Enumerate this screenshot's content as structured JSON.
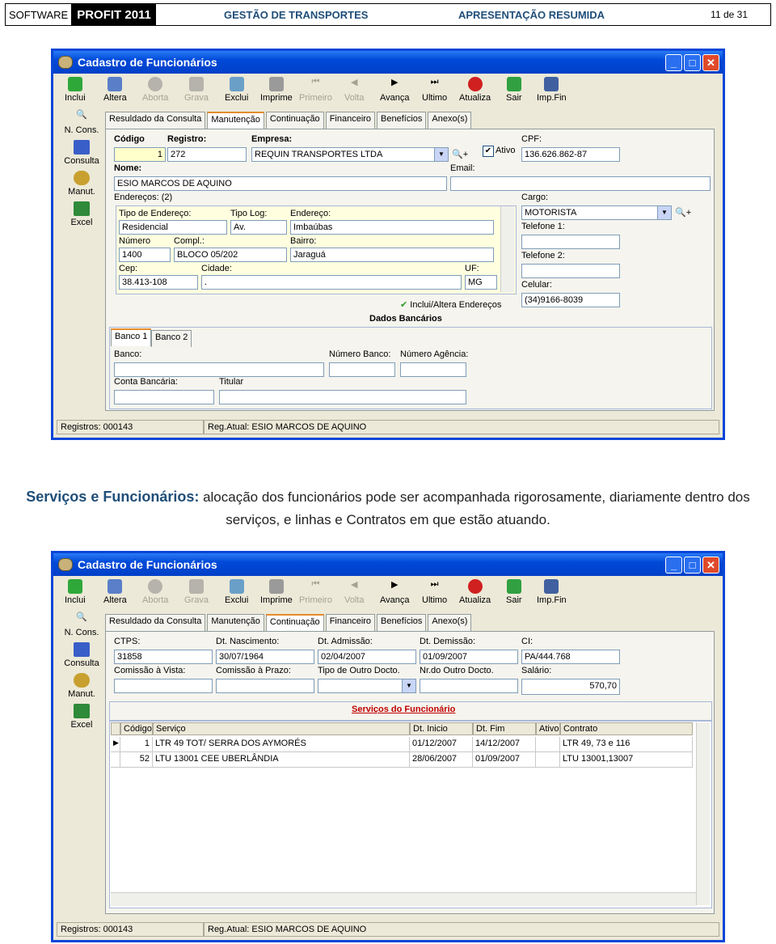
{
  "header": {
    "software": "SOFTWARE",
    "product": "PROFIT 2011",
    "module": "GESTÃO DE TRANSPORTES",
    "section": "APRESENTAÇÃO RESUMIDA",
    "page": "11 de 31"
  },
  "window": {
    "title": "Cadastro de Funcionários",
    "toolbar": [
      "Inclui",
      "Altera",
      "Aborta",
      "Grava",
      "Exclui",
      "Imprime",
      "Primeiro",
      "Volta",
      "Avança",
      "Ultimo",
      "Atualiza",
      "Sair",
      "Imp.Fin"
    ],
    "sidebar": [
      "N. Cons.",
      "Consulta",
      "Manut.",
      "Excel"
    ],
    "tabs": [
      "Resuldado da Consulta",
      "Manutenção",
      "Continuação",
      "Financeiro",
      "Benefícios",
      "Anexo(s)"
    ],
    "status_left": "Registros: 000143",
    "status_right": "Reg.Atual: ESIO MARCOS DE AQUINO",
    "colors": {
      "title_bar": "#0049d8",
      "selected_field": "#ffffcc"
    }
  },
  "form1": {
    "codigo_label": "Código",
    "codigo": "1",
    "registro_label": "Registro:",
    "registro": "272",
    "empresa_label": "Empresa:",
    "empresa": "REQUIN TRANSPORTES LTDA",
    "ativo_label": "Ativo",
    "cpf_label": "CPF:",
    "cpf": "136.626.862-87",
    "nome_label": "Nome:",
    "nome": "ESIO MARCOS DE AQUINO",
    "email_label": "Email:",
    "enderecos_label": "Endereços: (2)",
    "tipo_end_label": "Tipo de Endereço:",
    "tipo_end": "Residencial",
    "tipo_log_label": "Tipo Log:",
    "tipo_log": "Av.",
    "endereco_label": "Endereço:",
    "endereco": "Imbaúbas",
    "numero_label": "Número",
    "numero": "1400",
    "compl_label": "Compl.:",
    "compl": "BLOCO 05/202",
    "bairro_label": "Bairro:",
    "bairro": "Jaraguá",
    "cep_label": "Cep:",
    "cep": "38.413-108",
    "cidade_label": "Cidade:",
    "cidade": ".",
    "uf_label": "UF:",
    "uf": "MG",
    "inclui_end": "Inclui/Altera Endereços",
    "cargo_label": "Cargo:",
    "cargo": "MOTORISTA",
    "tel1_label": "Telefone 1:",
    "tel2_label": "Telefone 2:",
    "celular_label": "Celular:",
    "celular": "(34)9166-8039",
    "dados_bancarios": "Dados Bancários",
    "banco_tabs": [
      "Banco 1",
      "Banco 2"
    ],
    "banco_label": "Banco:",
    "num_banco_label": "Número Banco:",
    "num_agencia_label": "Número Agência:",
    "conta_label": "Conta Bancária:",
    "titular_label": "Titular"
  },
  "caption": {
    "bold": "Serviços e Funcionários:",
    "text": "alocação dos funcionários pode ser acompanhada rigorosamente, diariamente dentro dos serviços, e linhas e Contratos em que estão atuando."
  },
  "form2": {
    "ctps_label": "CTPS:",
    "ctps": "31858",
    "nasc_label": "Dt. Nascimento:",
    "nasc": "30/07/1964",
    "admissao_label": "Dt. Admissão:",
    "admissao": "02/04/2007",
    "demissao_label": "Dt. Demissão:",
    "demissao": "01/09/2007",
    "ci_label": "CI:",
    "ci": "PA/444.768",
    "com_vista_label": "Comissão à Vista:",
    "com_prazo_label": "Comissão à Prazo:",
    "tipo_doc_label": "Tipo de Outro Docto.",
    "nr_doc_label": "Nr.do Outro Docto.",
    "salario_label": "Salário:",
    "salario": "570,70",
    "grid_title": "Serviços do Funcionário",
    "columns": [
      "Código",
      "Serviço",
      "Dt. Inicio",
      "Dt. Fim",
      "Ativo",
      "Contrato"
    ],
    "rows": [
      [
        "1",
        "LTR 49 TOT/ SERRA DOS AYMORÉS",
        "01/12/2007",
        "14/12/2007",
        "",
        "LTR 49, 73 e 116"
      ],
      [
        "52",
        "LTU 13001 CEE UBERLÂNDIA",
        "28/06/2007",
        "01/09/2007",
        "",
        "LTU 13001,13007"
      ]
    ]
  }
}
